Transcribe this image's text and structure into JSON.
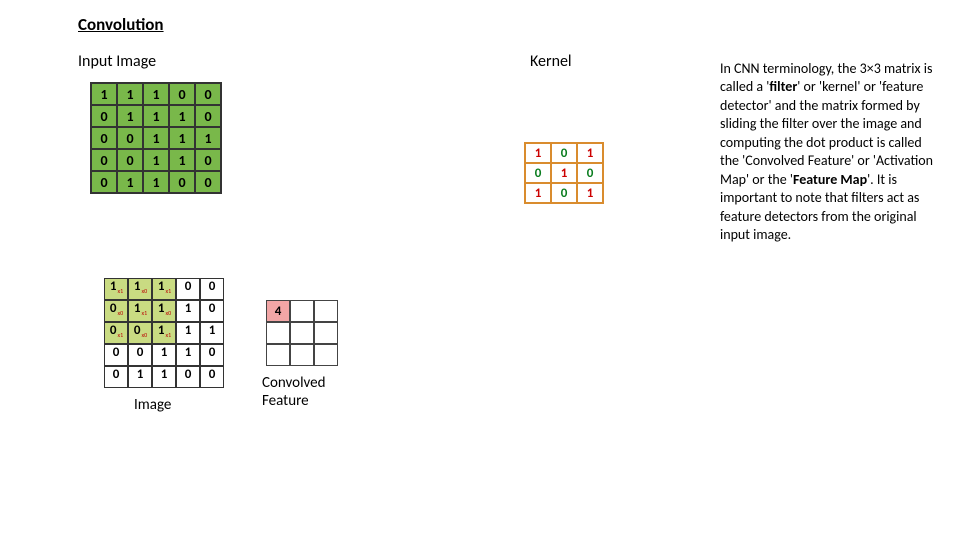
{
  "title": "Convolution",
  "inputImageLabel": "Input Image",
  "kernelLabel": "Kernel",
  "imageLabel2": "Image",
  "convolvedLabel1": "Convolved",
  "convolvedLabel2": "Feature",
  "inputImage": [
    [
      1,
      1,
      1,
      0,
      0
    ],
    [
      0,
      1,
      1,
      1,
      0
    ],
    [
      0,
      0,
      1,
      1,
      1
    ],
    [
      0,
      0,
      1,
      1,
      0
    ],
    [
      0,
      1,
      1,
      0,
      0
    ]
  ],
  "kernel": [
    [
      1,
      0,
      1
    ],
    [
      0,
      1,
      0
    ],
    [
      1,
      0,
      1
    ]
  ],
  "imageWithOverlay": {
    "values": [
      [
        1,
        1,
        1,
        0,
        0
      ],
      [
        0,
        1,
        1,
        1,
        0
      ],
      [
        0,
        0,
        1,
        1,
        1
      ],
      [
        0,
        0,
        1,
        1,
        0
      ],
      [
        0,
        1,
        1,
        0,
        0
      ]
    ],
    "overlayRows": [
      0,
      1,
      2
    ],
    "overlayCols": [
      0,
      1,
      2
    ],
    "subscripts": [
      [
        "x1",
        "x0",
        "x1"
      ],
      [
        "x0",
        "x1",
        "x0"
      ],
      [
        "x1",
        "x0",
        "x1"
      ]
    ]
  },
  "convolved": {
    "rows": 3,
    "cols": 3,
    "firstValue": 4
  },
  "paragraph": {
    "t0": "In CNN terminology, the 3×3 matrix is called a '",
    "b1": "filter",
    "t1": "' or 'kernel' or 'feature detector' and the matrix formed by sliding the filter over the image and computing the dot product is called the 'Convolved Feature' or 'Activation Map' or the '",
    "b2": "Feature Map",
    "t2": "'. It is important to note that filters act as feature detectors from the original input image."
  }
}
